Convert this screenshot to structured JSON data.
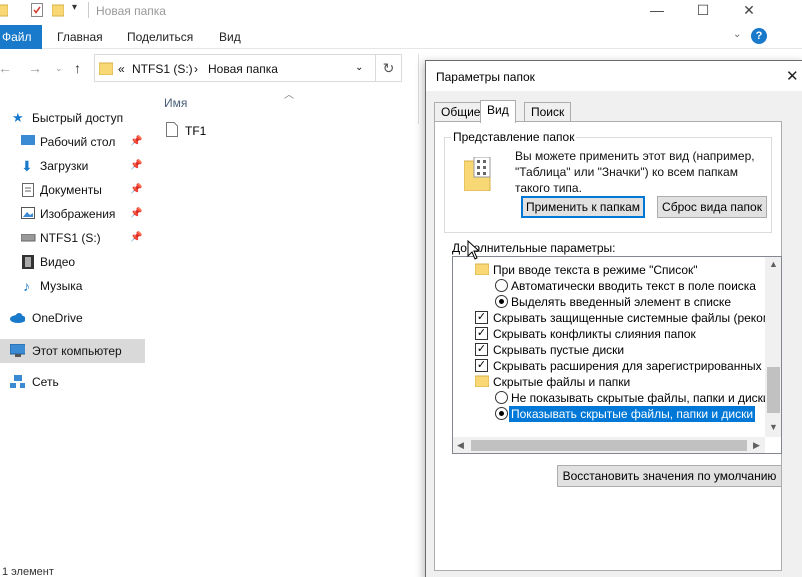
{
  "explorer": {
    "title": "Новая папка",
    "ribbon_tabs": [
      "Файл",
      "Главная",
      "Поделиться",
      "Вид"
    ],
    "address": {
      "drive": "NTFS1 (S:)",
      "folder": "Новая папка",
      "prefix": "«",
      "sep": "›"
    },
    "column_name": "Имя",
    "files": [
      "TF1"
    ],
    "status": "1 элемент",
    "help": "?",
    "sidebar": [
      {
        "label": "Быстрый доступ",
        "icon": "star-icon"
      },
      {
        "label": "Рабочий стол",
        "icon": "desktop-icon",
        "pinned": true
      },
      {
        "label": "Загрузки",
        "icon": "download-icon",
        "pinned": true
      },
      {
        "label": "Документы",
        "icon": "documents-icon",
        "pinned": true
      },
      {
        "label": "Изображения",
        "icon": "pictures-icon",
        "pinned": true
      },
      {
        "label": "NTFS1 (S:)",
        "icon": "drive-icon",
        "pinned": true
      },
      {
        "label": "Видео",
        "icon": "video-icon"
      },
      {
        "label": "Музыка",
        "icon": "music-icon"
      },
      {
        "label": "OneDrive",
        "icon": "cloud-icon"
      },
      {
        "label": "Этот компьютер",
        "icon": "computer-icon",
        "selected": true
      },
      {
        "label": "Сеть",
        "icon": "network-icon"
      }
    ]
  },
  "dialog": {
    "title": "Параметры папок",
    "tabs": [
      "Общие",
      "Вид",
      "Поиск"
    ],
    "active_tab": "Вид",
    "group_title": "Представление папок",
    "group_desc": "Вы можете применить этот вид (например, \"Таблица\" или \"Значки\") ко всем папкам такого типа.",
    "apply_button": "Применить к папкам",
    "reset_button": "Сброс вида папок",
    "advanced_label": "Дополнительные параметры:",
    "restore_button": "Восстановить значения по умолчанию",
    "options": [
      {
        "type": "folder",
        "text": "При вводе текста в режиме \"Список\""
      },
      {
        "type": "radio",
        "checked": false,
        "text": "Автоматически вводить текст в поле поиска"
      },
      {
        "type": "radio",
        "checked": true,
        "text": "Выделять введенный элемент в списке"
      },
      {
        "type": "checkbox",
        "checked": true,
        "text": "Скрывать защищенные системные файлы (рекомен,"
      },
      {
        "type": "checkbox",
        "checked": true,
        "text": "Скрывать конфликты слияния папок"
      },
      {
        "type": "checkbox",
        "checked": true,
        "text": "Скрывать пустые диски"
      },
      {
        "type": "checkbox",
        "checked": true,
        "text": "Скрывать расширения для зарегистрированных типо"
      },
      {
        "type": "folder",
        "text": "Скрытые файлы и папки"
      },
      {
        "type": "radio",
        "checked": false,
        "text": "Не показывать скрытые файлы, папки и диски"
      },
      {
        "type": "radio",
        "checked": true,
        "selected": true,
        "text": "Показывать скрытые файлы, папки и диски"
      }
    ]
  },
  "colors": {
    "accent": "#0078d7",
    "file_tab": "#1979ca",
    "nav_selected": "#d9d9d9"
  }
}
